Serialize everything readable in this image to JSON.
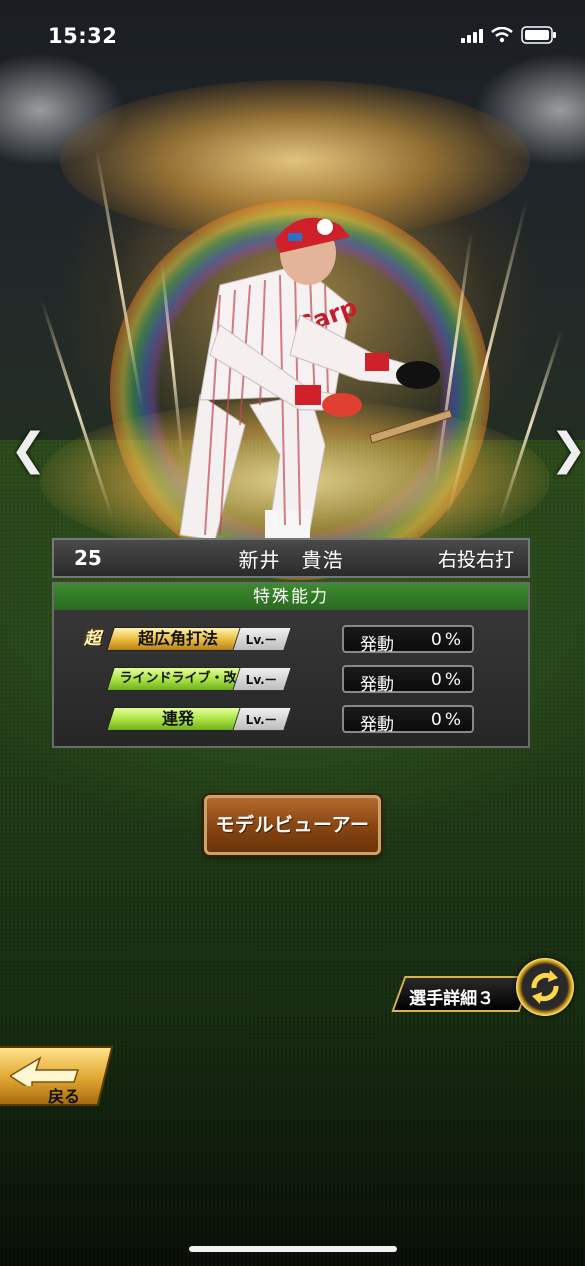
{
  "status_bar": {
    "time": "15:32"
  },
  "player": {
    "number": "25",
    "name": "新井　貴浩",
    "handedness": "右投右打"
  },
  "abilities_panel": {
    "title": "特殊能力",
    "abilities": [
      {
        "name": "超広角打法",
        "grade": "gold",
        "badge": "超",
        "level": "Lv.ー",
        "trigger_label": "発動",
        "trigger_value": "0%"
      },
      {
        "name": "ラインドライブ・改",
        "grade": "green",
        "badge": "",
        "level": "Lv.ー",
        "trigger_label": "発動",
        "trigger_value": "0%"
      },
      {
        "name": "連発",
        "grade": "green",
        "badge": "",
        "level": "Lv.ー",
        "trigger_label": "発動",
        "trigger_value": "0%"
      }
    ]
  },
  "buttons": {
    "model_viewer": "モデルビューアー",
    "player_detail": "選手詳細３",
    "back": "戻る"
  },
  "icons": {
    "prev": "chevron-left-icon",
    "next": "chevron-right-icon",
    "swap": "swap-icon"
  },
  "colors": {
    "panel_header": "#2f7a25",
    "gold_tag": "#e8b93a",
    "green_tag": "#a6e040",
    "button_brown": "#8a4713"
  }
}
